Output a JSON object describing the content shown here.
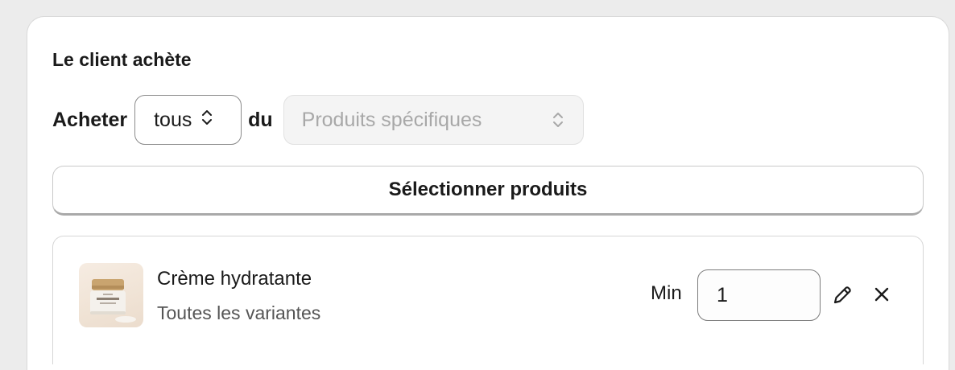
{
  "section": {
    "title": "Le client achète"
  },
  "buy_row": {
    "prefix": "Acheter",
    "quantity_select": {
      "value": "tous"
    },
    "connector": "du",
    "type_select": {
      "value": "Produits spécifiques",
      "disabled": true
    }
  },
  "select_products_button": "Sélectionner produits",
  "product": {
    "name": "Crème hydratante",
    "variants": "Toutes les variantes",
    "thumbnail_icon": "moisturizer-jar-image",
    "min_label": "Min",
    "min_value": "1",
    "edit_icon": "pencil-icon",
    "remove_icon": "close-icon"
  }
}
